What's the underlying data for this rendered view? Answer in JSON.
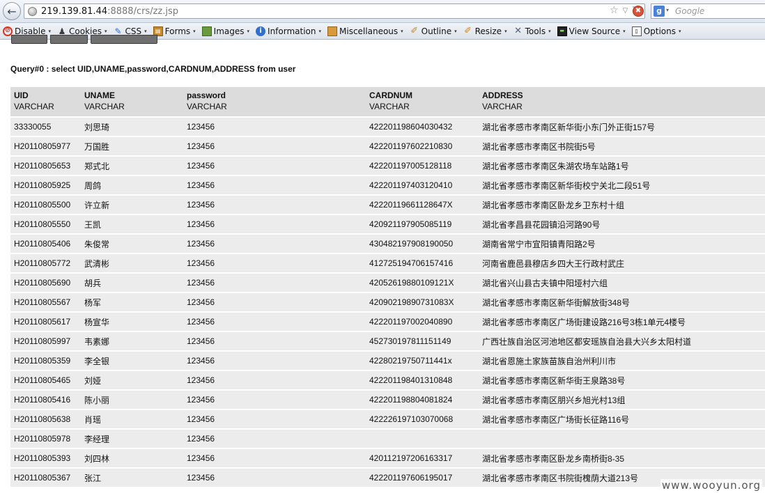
{
  "browser": {
    "url_host": "219.139.81.44",
    "url_rest": ":8888/crs/zz.jsp",
    "search_engine_letter": "g",
    "search_placeholder": "Google",
    "back_glyph": "←",
    "star_glyph": "☆",
    "dropdown_glyph": "▽",
    "reload_glyph": "↻",
    "stop_glyph": "✖",
    "caret_glyph": "▾"
  },
  "devbar": {
    "items": [
      {
        "label": "Disable",
        "icon": "disable-icon"
      },
      {
        "label": "Cookies",
        "icon": "cookies-icon"
      },
      {
        "label": "CSS",
        "icon": "css-icon"
      },
      {
        "label": "Forms",
        "icon": "forms-icon"
      },
      {
        "label": "Images",
        "icon": "images-icon"
      },
      {
        "label": "Information",
        "icon": "information-icon"
      },
      {
        "label": "Miscellaneous",
        "icon": "miscellaneous-icon"
      },
      {
        "label": "Outline",
        "icon": "outline-icon"
      },
      {
        "label": "Resize",
        "icon": "resize-icon"
      },
      {
        "label": "Tools",
        "icon": "tools-icon"
      },
      {
        "label": "View Source",
        "icon": "view-source-icon"
      },
      {
        "label": "Options",
        "icon": "options-icon"
      }
    ]
  },
  "page": {
    "query_title": "Query#0 : select UID,UNAME,password,CARDNUM,ADDRESS from user",
    "columns": [
      {
        "name": "UID",
        "type": "VARCHAR"
      },
      {
        "name": "UNAME",
        "type": "VARCHAR"
      },
      {
        "name": "password",
        "type": "VARCHAR"
      },
      {
        "name": "CARDNUM",
        "type": "VARCHAR"
      },
      {
        "name": "ADDRESS",
        "type": "VARCHAR"
      }
    ],
    "rows": [
      [
        "33330055",
        "刘思琦",
        "123456",
        "422201198604030432",
        "湖北省孝感市孝南区新华街小东门外正街157号"
      ],
      [
        "H20110805977",
        "万国胜",
        "123456",
        "422201197602210830",
        "湖北省孝感市孝南区书院街5号"
      ],
      [
        "H20110805653",
        "郑式北",
        "123456",
        "422201197005128118",
        "湖北省孝感市孝南区朱湖农场车站路1号"
      ],
      [
        "H20110805925",
        "周鸽",
        "123456",
        "422201197403120410",
        "湖北省孝感市孝南区新华街校宁关北二段51号"
      ],
      [
        "H20110805500",
        "许立新",
        "123456",
        "42220119661128647X",
        "湖北省孝感市孝南区卧龙乡卫东村十组"
      ],
      [
        "H20110805550",
        "王凯",
        "123456",
        "420921197905085119",
        "湖北省孝昌县花园镇沿河路90号"
      ],
      [
        "H20110805406",
        "朱俊常",
        "123456",
        "430482197908190050",
        "湖南省常宁市宜阳镇青阳路2号"
      ],
      [
        "H20110805772",
        "武清彬",
        "123456",
        "412725194706157416",
        "河南省鹿邑县穆店乡四大王行政村武庄"
      ],
      [
        "H20110805690",
        "胡兵",
        "123456",
        "42052619880109121X",
        "湖北省兴山县古夫镇中阳垭村六组"
      ],
      [
        "H20110805567",
        "杨军",
        "123456",
        "42090219890731083X",
        "湖北省孝感市孝南区新华街解放街348号"
      ],
      [
        "H20110805617",
        "杨宣华",
        "123456",
        "422201197002040890",
        "湖北省孝感市孝南区广场街建设路216号3栋1单元4楼号"
      ],
      [
        "H20110805997",
        "韦素娜",
        "123456",
        "452730197811151149",
        "广西壮族自治区河池地区都安瑶族自治县大兴乡太阳村道"
      ],
      [
        "H20110805359",
        "李全银",
        "123456",
        "42280219750711441x",
        "湖北省恩施土家族苗族自治州利川市"
      ],
      [
        "H20110805465",
        "刘娅",
        "123456",
        "422201198401310848",
        "湖北省孝感市孝南区新华街王泉路38号"
      ],
      [
        "H20110805416",
        "陈小丽",
        "123456",
        "422201198804081824",
        "湖北省孝感市孝南区朋兴乡旭光村13组"
      ],
      [
        "H20110805638",
        "肖瑶",
        "123456",
        "422226197103070068",
        "湖北省孝感市孝南区广场街长征路116号"
      ],
      [
        "H20110805978",
        "李经理",
        "123456",
        "",
        ""
      ],
      [
        "H20110805393",
        "刘四林",
        "123456",
        "420112197206163317",
        "湖北省孝感市孝南区卧龙乡南桥街8-35"
      ],
      [
        "H20110805367",
        "张江",
        "123456",
        "422201197606195017",
        "湖北省孝感市孝南区书院街槐荫大道213号"
      ]
    ]
  },
  "watermark": "www.wooyun.org"
}
